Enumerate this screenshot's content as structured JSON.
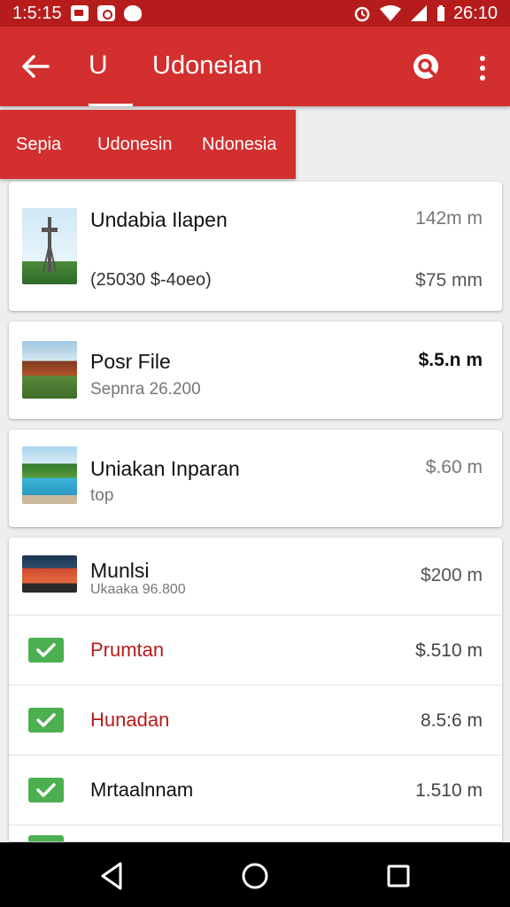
{
  "status_bar": {
    "time": "1:5:15",
    "right_time": "26:10",
    "icons": [
      "image-notification-icon",
      "camera-notification-icon",
      "message-notification-icon",
      "alarm-icon",
      "wifi-icon",
      "signal-icon",
      "battery-icon"
    ]
  },
  "app_bar": {
    "initial": "U",
    "title": "Udoneian",
    "icons": [
      "back-arrow-icon",
      "search-icon",
      "more-vert-icon"
    ]
  },
  "tabs": [
    "Sepia",
    "Udonesin",
    "Ndonesia"
  ],
  "items": [
    {
      "title": "Undabia Ilapen",
      "subtitle": "(25030 $-4oeo)",
      "value_top": "142m m",
      "value_bottom": "$75 mm"
    },
    {
      "title": "Posr File",
      "subtitle": "Sepnra 26.200",
      "value": "$.5.n m"
    },
    {
      "title": "Uniakan Inparan",
      "subtitle": "top",
      "value": "$.60 m"
    }
  ],
  "list_card": {
    "header": {
      "title": "Munlsi",
      "subtitle": "Ukaaka 96.800",
      "value": "$200 m"
    },
    "rows": [
      {
        "label": "Prumtan",
        "value": "$.510 m",
        "checked": true,
        "label_color": "#b71c1c"
      },
      {
        "label": "Hunadan",
        "value": "8.5:6 m",
        "checked": true,
        "label_color": "#b71c1c"
      },
      {
        "label": "Mrtaalnnam",
        "value": "1.510 m",
        "checked": true,
        "label_color": "#111111"
      }
    ]
  },
  "colors": {
    "primary": "#d32f2f",
    "primary_dark": "#b71c1c",
    "check_green": "#4caf50"
  },
  "nav": [
    "back-triangle-icon",
    "home-circle-icon",
    "recents-square-icon"
  ]
}
